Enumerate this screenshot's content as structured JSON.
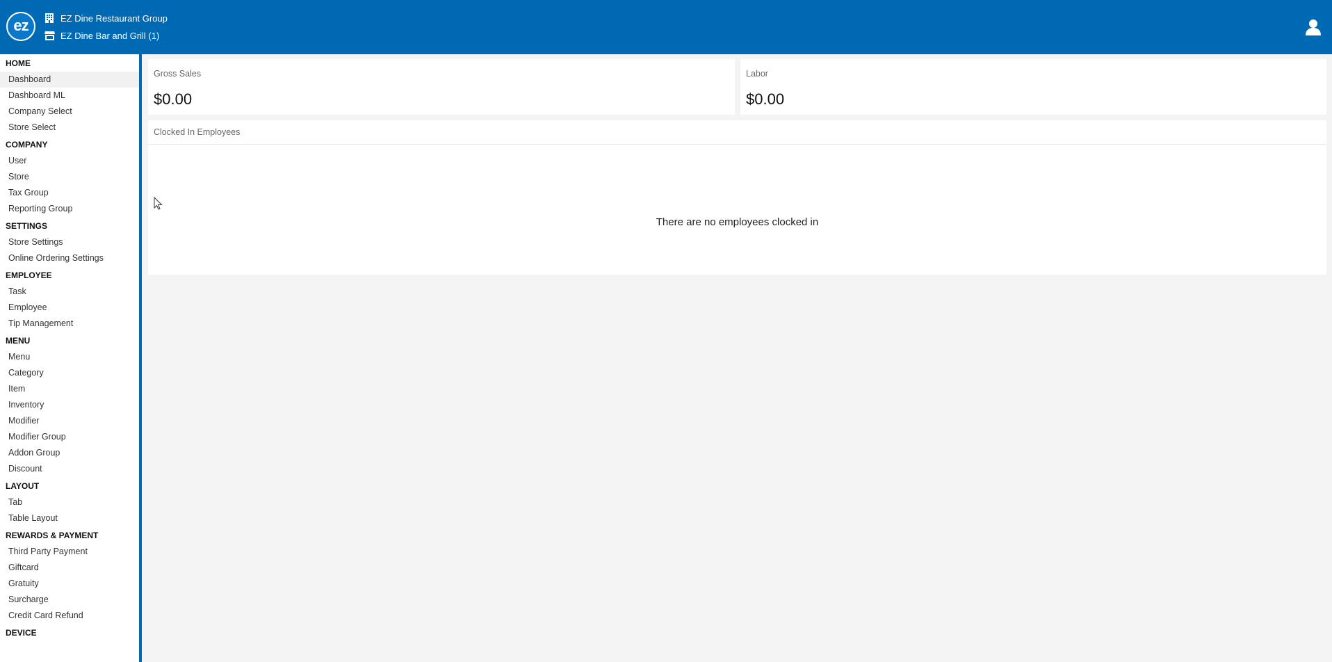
{
  "header": {
    "logo_text": "ez",
    "company_name": "EZ Dine Restaurant Group",
    "store_name": "EZ Dine Bar and Grill (1)",
    "icons": {
      "company": "building-icon",
      "store": "store-icon",
      "user": "user-icon"
    }
  },
  "sidebar": {
    "home": {
      "title": "HOME",
      "items": [
        "Dashboard",
        "Dashboard ML",
        "Company Select",
        "Store Select"
      ]
    },
    "company": {
      "title": "COMPANY",
      "items": [
        "User",
        "Store",
        "Tax Group",
        "Reporting Group"
      ]
    },
    "settings": {
      "title": "SETTINGS",
      "items": [
        "Store Settings",
        "Online Ordering Settings"
      ]
    },
    "employee": {
      "title": "EMPLOYEE",
      "items": [
        "Task",
        "Employee",
        "Tip Management"
      ]
    },
    "menu": {
      "title": "MENU",
      "items": [
        "Menu",
        "Category",
        "Item",
        "Inventory",
        "Modifier",
        "Modifier Group",
        "Addon Group",
        "Discount"
      ]
    },
    "layout": {
      "title": "LAYOUT",
      "items": [
        "Tab",
        "Table Layout"
      ]
    },
    "rewards": {
      "title": "REWARDS & PAYMENT",
      "items": [
        "Third Party Payment",
        "Giftcard",
        "Gratuity",
        "Surcharge",
        "Credit Card Refund"
      ]
    },
    "device": {
      "title": "DEVICE"
    }
  },
  "main": {
    "gross_sales": {
      "label": "Gross Sales",
      "value": "$0.00"
    },
    "labor": {
      "label": "Labor",
      "value": "$0.00"
    },
    "clocked_in": {
      "title": "Clocked In Employees",
      "empty_message": "There are no employees clocked in"
    }
  },
  "colors": {
    "primary": "#0069b4",
    "background": "#f4f4f4",
    "card": "#ffffff"
  }
}
